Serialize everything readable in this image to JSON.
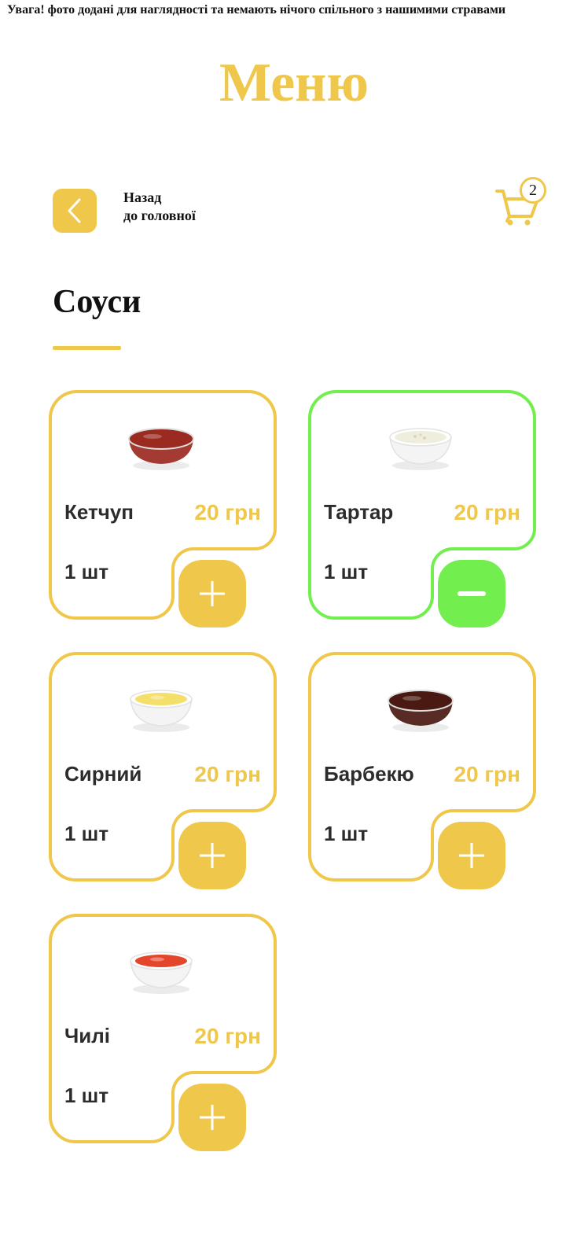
{
  "notice": "Увага! фото додані для наглядності та немають нічого спільного з нашимими стравами",
  "title": "Меню",
  "back": {
    "line1": "Назад",
    "line2": "до головної"
  },
  "cart": {
    "count": "2"
  },
  "section": {
    "title": "Соуси"
  },
  "colors": {
    "accent": "#efc74a",
    "selected": "#72ef4f",
    "text": "#2c2c2c"
  },
  "items": [
    {
      "name": "Кетчуп",
      "price": "20 грн",
      "qty": "1 шт",
      "selected": false,
      "action": "plus-icon",
      "dish": "ketchup"
    },
    {
      "name": "Тартар",
      "price": "20 грн",
      "qty": "1 шт",
      "selected": true,
      "action": "minus-icon",
      "dish": "tartar"
    },
    {
      "name": "Сирний",
      "price": "20 грн",
      "qty": "1 шт",
      "selected": false,
      "action": "plus-icon",
      "dish": "cheese"
    },
    {
      "name": "Барбекю",
      "price": "20 грн",
      "qty": "1 шт",
      "selected": false,
      "action": "plus-icon",
      "dish": "bbq"
    },
    {
      "name": "Чилі",
      "price": "20 грн",
      "qty": "1 шт",
      "selected": false,
      "action": "plus-icon",
      "dish": "chili"
    }
  ]
}
